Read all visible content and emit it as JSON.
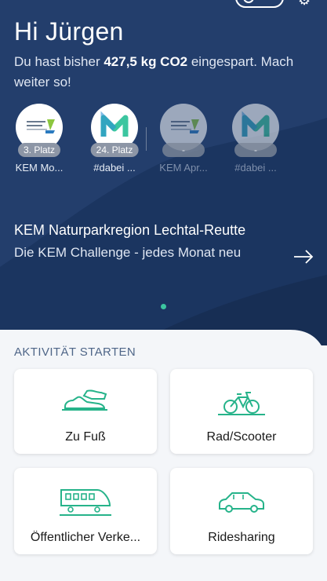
{
  "header": {
    "greeting": "Hi Jürgen",
    "savings_prefix": "Du hast bisher ",
    "savings_value": "427,5 kg CO2",
    "savings_suffix": " eingespart. Mach weiter so!"
  },
  "badges": [
    {
      "rank": "3. Platz",
      "name": "KEM Mo...",
      "logo": "kem-logo",
      "active": true
    },
    {
      "rank": "24. Platz",
      "name": "#dabei ...",
      "logo": "dabei-logo",
      "active": true
    },
    {
      "rank": "-",
      "name": "KEM Apr...",
      "logo": "kem-logo",
      "active": false
    },
    {
      "rank": "-",
      "name": "#dabei ...",
      "logo": "dabei-logo",
      "active": false
    }
  ],
  "challenge": {
    "title": "KEM Naturparkregion Lechtal-Reutte",
    "subtitle": "Die KEM Challenge - jedes Monat neu"
  },
  "activities": {
    "section_title": "AKTIVITÄT STARTEN",
    "items": [
      {
        "label": "Zu Fuß",
        "icon": "shoe-icon"
      },
      {
        "label": "Rad/Scooter",
        "icon": "bicycle-icon"
      },
      {
        "label": "Öffentlicher Verke...",
        "icon": "train-icon"
      },
      {
        "label": "Ridesharing",
        "icon": "car-icon"
      }
    ]
  },
  "colors": {
    "hero_dark": "#1b3560",
    "hero_light": "#243f6e",
    "accent_green": "#3cc6a0",
    "section_text": "#4f6688"
  }
}
